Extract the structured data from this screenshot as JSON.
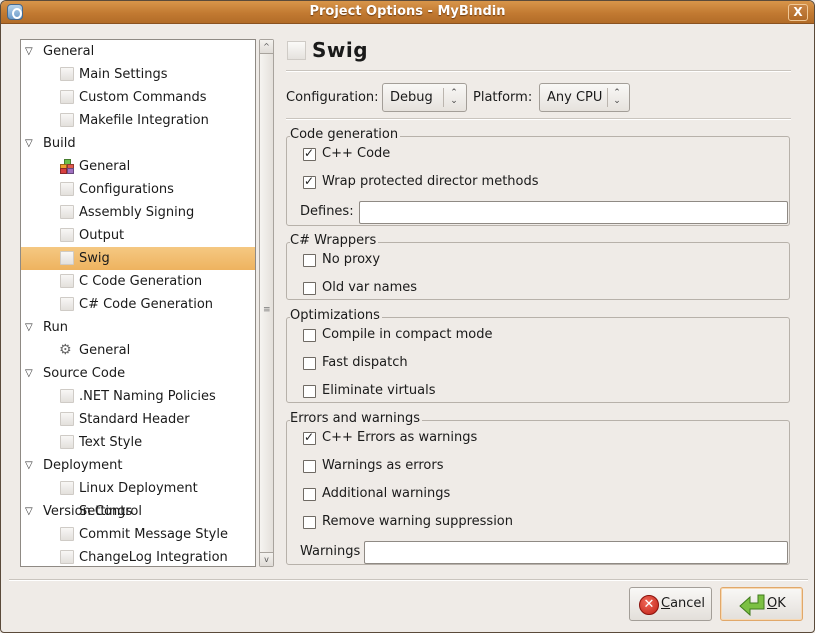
{
  "window": {
    "title": "Project Options - MyBindin",
    "close_label": "X"
  },
  "tree": {
    "rows": [
      {
        "type": "category",
        "label": "General",
        "expanded": true
      },
      {
        "type": "item",
        "label": "Main Settings",
        "icon": "blank-page-icon"
      },
      {
        "type": "item",
        "label": "Custom Commands",
        "icon": "blank-page-icon"
      },
      {
        "type": "item",
        "label": "Makefile Integration",
        "icon": "blank-page-icon"
      },
      {
        "type": "category",
        "label": "Build",
        "expanded": true
      },
      {
        "type": "item",
        "label": "General",
        "icon": "build-blocks-icon"
      },
      {
        "type": "item",
        "label": "Configurations",
        "icon": "blank-page-icon"
      },
      {
        "type": "item",
        "label": "Assembly Signing",
        "icon": "blank-page-icon"
      },
      {
        "type": "item",
        "label": "Output",
        "icon": "blank-page-icon"
      },
      {
        "type": "item",
        "label": "Swig",
        "icon": "blank-page-icon",
        "selected": true
      },
      {
        "type": "item",
        "label": "C Code Generation",
        "icon": "blank-page-icon"
      },
      {
        "type": "item",
        "label": "C# Code Generation",
        "icon": "blank-page-icon"
      },
      {
        "type": "category",
        "label": "Run",
        "expanded": true
      },
      {
        "type": "item",
        "label": "General",
        "icon": "gears-icon"
      },
      {
        "type": "category",
        "label": "Source Code",
        "expanded": true
      },
      {
        "type": "item",
        "label": ".NET Naming Policies",
        "icon": "blank-page-icon"
      },
      {
        "type": "item",
        "label": "Standard Header",
        "icon": "blank-page-icon"
      },
      {
        "type": "item",
        "label": "Text Style",
        "icon": "blank-page-icon"
      },
      {
        "type": "category",
        "label": "Deployment",
        "expanded": true
      },
      {
        "type": "item",
        "label": "Linux Deployment Settings",
        "icon": "blank-page-icon"
      },
      {
        "type": "category",
        "label": "Version Control",
        "expanded": true
      },
      {
        "type": "item",
        "label": "Commit Message Style",
        "icon": "blank-page-icon"
      },
      {
        "type": "item",
        "label": "ChangeLog Integration",
        "icon": "blank-page-icon"
      }
    ]
  },
  "page": {
    "title": "Swig",
    "configuration_label": "Configuration:",
    "configuration_value": "Debug",
    "platform_label": "Platform:",
    "platform_value": "Any CPU"
  },
  "sections": {
    "code_generation": {
      "title": "Code generation",
      "options": [
        {
          "label": "C++ Code",
          "checked": true
        },
        {
          "label": "Wrap protected director methods",
          "checked": true
        }
      ],
      "defines_label": "Defines:",
      "defines_value": ""
    },
    "csharp_wrappers": {
      "title": "C# Wrappers",
      "options": [
        {
          "label": "No proxy",
          "checked": false
        },
        {
          "label": "Old var names",
          "checked": false
        }
      ]
    },
    "optimizations": {
      "title": "Optimizations",
      "options": [
        {
          "label": "Compile in compact mode",
          "checked": false
        },
        {
          "label": "Fast dispatch",
          "checked": false
        },
        {
          "label": "Eliminate virtuals",
          "checked": false
        }
      ]
    },
    "errors_warnings": {
      "title": "Errors and warnings",
      "options": [
        {
          "label": "C++ Errors as warnings",
          "checked": true
        },
        {
          "label": "Warnings as errors",
          "checked": false
        },
        {
          "label": "Additional warnings",
          "checked": false
        },
        {
          "label": "Remove warning suppression",
          "checked": false
        }
      ],
      "warnings_label": "Warnings",
      "warnings_value": ""
    }
  },
  "buttons": {
    "cancel_mnemonic": "C",
    "cancel_rest": "ancel",
    "ok_mnemonic": "O",
    "ok_rest": "K"
  },
  "colors": {
    "titlebar": "#c27a32",
    "selection": "#f0b868",
    "window_bg": "#efebe7"
  }
}
